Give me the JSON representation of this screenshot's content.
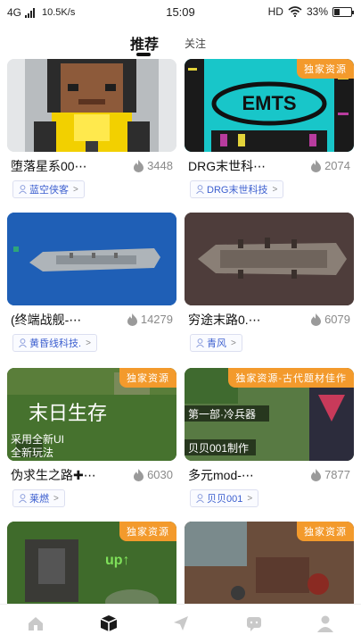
{
  "status_bar": {
    "network": "4G",
    "speed": "10.5K/s",
    "time": "15:09",
    "hd": "HD",
    "battery": "33%",
    "battery_level": 0.33
  },
  "tabs": {
    "recommend": "推荐",
    "follow": "关注"
  },
  "cards": [
    {
      "title": "堕落星系00⋯",
      "heat": "3448",
      "author": "蓝空侠客",
      "badge": ""
    },
    {
      "title": "DRG末世科⋯",
      "heat": "2074",
      "author": "DRG末世科技",
      "badge": "独家资源"
    },
    {
      "title": "(终端战舰-⋯",
      "heat": "14279",
      "author": "黄昏线科技.",
      "badge": ""
    },
    {
      "title": "穷途末路0.⋯",
      "heat": "6079",
      "author": "青风",
      "badge": ""
    },
    {
      "title": "伪求生之路✚⋯",
      "heat": "6030",
      "author": "莱燃",
      "badge": "独家资源"
    },
    {
      "title": "多元mod-⋯",
      "heat": "7877",
      "author": "贝贝001",
      "badge": "独家资源-古代题材佳作"
    },
    {
      "title": "",
      "heat": "",
      "author": "",
      "badge": "独家资源"
    },
    {
      "title": "",
      "heat": "",
      "author": "",
      "badge": "独家资源"
    }
  ],
  "thumb_text": {
    "emts": "EMTS",
    "end_day": "末日生存",
    "new_ui": "采用全新UI",
    "new_play": "全新玩法",
    "up": "up↑",
    "part1": "第一部·冷兵器",
    "beibei": "贝贝001制作"
  },
  "bottom_nav": {
    "home": "home-icon",
    "box": "box-icon",
    "send": "send-icon",
    "chat": "chat-icon",
    "profile": "profile-icon"
  },
  "colors": {
    "badge": "#f39a2c",
    "author_text": "#3c5fcf",
    "heat_text": "#8a8a8a"
  }
}
